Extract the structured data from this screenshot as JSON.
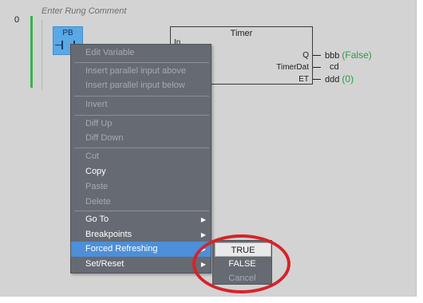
{
  "rung": {
    "number": "0",
    "comment_placeholder": "Enter Rung Comment"
  },
  "contact": {
    "variable": "PB"
  },
  "timer": {
    "title": "Timer",
    "input_pin": "In",
    "pins": [
      {
        "label": "Q"
      },
      {
        "label": "TimerDat"
      },
      {
        "label": "ET"
      }
    ],
    "outputs": [
      {
        "name": "bbb",
        "value": "(False)"
      },
      {
        "name": "cd",
        "value": ""
      },
      {
        "name": "ddd",
        "value": "(0)"
      }
    ]
  },
  "context_menu": {
    "edit_variable": "Edit Variable",
    "insert_parallel_above": "Insert parallel input above",
    "insert_parallel_below": "Insert parallel input below",
    "invert": "Invert",
    "diff_up": "Diff Up",
    "diff_down": "Diff Down",
    "cut": "Cut",
    "copy": "Copy",
    "paste": "Paste",
    "delete": "Delete",
    "go_to": "Go To",
    "breakpoints": "Breakpoints",
    "forced_refreshing": "Forced Refreshing",
    "set_reset": "Set/Reset"
  },
  "submenu": {
    "true_label": "TRUE",
    "false_label": "FALSE",
    "cancel_label": "Cancel"
  },
  "colors": {
    "rail": "#34b44a",
    "value_text": "#2f9a44",
    "menu_highlight": "#4d8fd8",
    "annotation": "#d4242a"
  }
}
